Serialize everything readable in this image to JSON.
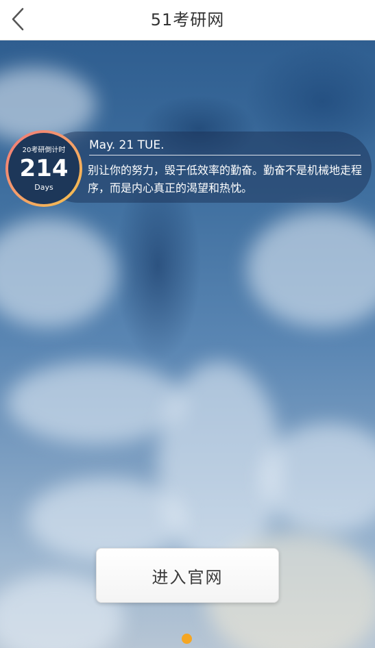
{
  "header": {
    "title": "51考研网",
    "back_icon": "chevron-left-icon"
  },
  "countdown": {
    "caption": "20考研倒计时",
    "days": "214",
    "unit": "Days"
  },
  "info": {
    "date": "May. 21  TUE.",
    "quote": "别让你的努力，毁于低效率的勤奋。勤奋不是机械地走程序，而是内心真正的渴望和热忱。"
  },
  "enter_button": {
    "label": "进入官网"
  },
  "pager": {
    "current": 1,
    "total": 1
  },
  "colors": {
    "accent": "#f5a623",
    "badge_fill": "#1d3759",
    "header_text": "#333333"
  }
}
